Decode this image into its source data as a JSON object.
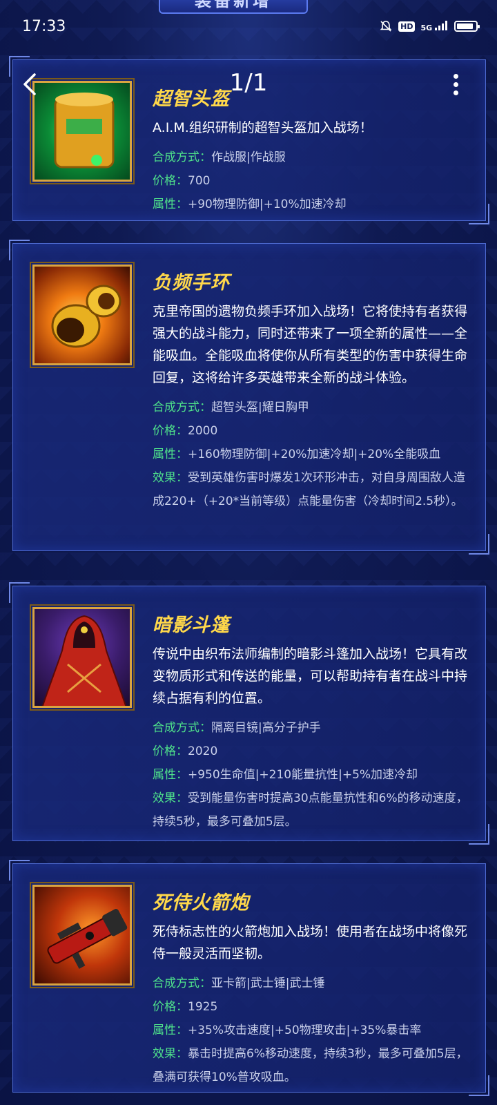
{
  "status_bar": {
    "time": "17:33",
    "hd": "HD",
    "network": "5G",
    "battery_level": 0.9
  },
  "banner": {
    "text": "装备新增"
  },
  "nav": {
    "page_indicator": "1/1"
  },
  "items": [
    {
      "name": "超智头盔",
      "desc": "A.I.M.组织研制的超智头盔加入战场！",
      "craft_label": "合成方式：",
      "craft": "作战服|作战服",
      "price_label": "价格：",
      "price": "700",
      "attr_label": "属性：",
      "attr": "+90物理防御|+10%加速冷却"
    },
    {
      "name": "负频手环",
      "desc": "克里帝国的遗物负频手环加入战场！它将使持有者获得强大的战斗能力，同时还带来了一项全新的属性——全能吸血。全能吸血将使你从所有类型的伤害中获得生命回复，这将给许多英雄带来全新的战斗体验。",
      "craft_label": "合成方式：",
      "craft": "超智头盔|耀日胸甲",
      "price_label": "价格：",
      "price": "2000",
      "attr_label": "属性：",
      "attr": "+160物理防御|+20%加速冷却|+20%全能吸血",
      "effect_label": "效果：",
      "effect": "受到英雄伤害时爆发1次环形冲击，对自身周围敌人造成220+（+20*当前等级）点能量伤害（冷却时间2.5秒）。"
    },
    {
      "name": "暗影斗篷",
      "desc": "传说中由织布法师编制的暗影斗篷加入战场！它具有改变物质形式和传送的能量，可以帮助持有者在战斗中持续占据有利的位置。",
      "craft_label": "合成方式：",
      "craft": "隔离目镜|高分子护手",
      "price_label": "价格：",
      "price": "2020",
      "attr_label": "属性：",
      "attr": "+950生命值|+210能量抗性|+5%加速冷却",
      "effect_label": "效果：",
      "effect": "受到能量伤害时提高30点能量抗性和6%的移动速度，持续5秒，最多可叠加5层。"
    },
    {
      "name": "死侍火箭炮",
      "desc": "死侍标志性的火箭炮加入战场！使用者在战场中将像死侍一般灵活而坚韧。",
      "craft_label": "合成方式：",
      "craft": "亚卡箭|武士锤|武士锤",
      "price_label": "价格：",
      "price": "1925",
      "attr_label": "属性：",
      "attr": "+35%攻击速度|+50物理攻击|+35%暴击率",
      "effect_label": "效果：",
      "effect": "暴击时提高6%移动速度，持续3秒，最多可叠加5层，叠满可获得10%普攻吸血。"
    }
  ],
  "colors": {
    "title": "#ffd84a",
    "label_green": "#4fe38b",
    "card_border": "#4d6ad0",
    "thumb_border": "#d9a441"
  }
}
